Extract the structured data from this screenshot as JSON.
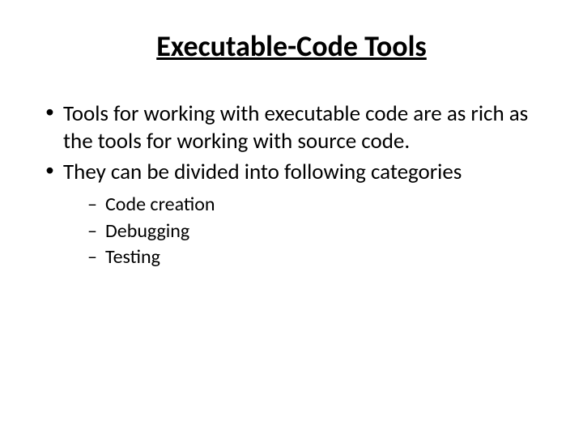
{
  "title": "Executable-Code Tools",
  "bullets": [
    "Tools for working with executable code are as rich as the tools for working with source code.",
    "They can be divided into following categories"
  ],
  "sub_bullets": [
    "Code creation",
    "Debugging",
    "Testing"
  ]
}
